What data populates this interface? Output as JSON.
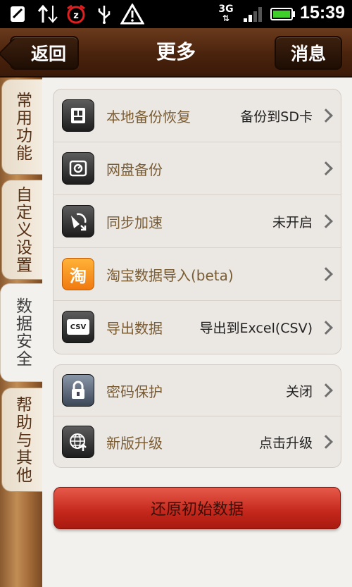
{
  "status_bar": {
    "time": "15:39",
    "network": "3G",
    "icons": [
      "sd-card-icon",
      "data-transfer-icon",
      "alarm-clock-icon",
      "usb-icon",
      "warning-icon",
      "signal-icon",
      "battery-icon"
    ]
  },
  "header": {
    "back_label": "返回",
    "title": "更多",
    "messages_label": "消息"
  },
  "sidebar": {
    "tabs": [
      {
        "label": "常用功能",
        "active": false
      },
      {
        "label": "自定义设置",
        "active": false
      },
      {
        "label": "数据安全",
        "active": true
      },
      {
        "label": "帮助与其他",
        "active": false
      }
    ]
  },
  "groups": [
    {
      "rows": [
        {
          "icon": "local-backup-icon",
          "label": "本地备份恢复",
          "value": "备份到SD卡"
        },
        {
          "icon": "cloud-drive-icon",
          "label": "网盘备份",
          "value": ""
        },
        {
          "icon": "satellite-sync-icon",
          "label": "同步加速",
          "value": "未开启"
        },
        {
          "icon": "taobao-icon",
          "icon_text": "淘",
          "label": "淘宝数据导入(beta)",
          "value": ""
        },
        {
          "icon": "csv-export-icon",
          "icon_text": "CSV",
          "label": "导出数据",
          "value": "导出到Excel(CSV)"
        }
      ]
    },
    {
      "rows": [
        {
          "icon": "lock-icon",
          "label": "密码保护",
          "value": "关闭"
        },
        {
          "icon": "globe-upgrade-icon",
          "label": "新版升级",
          "value": "点击升级"
        }
      ]
    }
  ],
  "reset_button": {
    "label": "还原初始数据"
  },
  "colors": {
    "accent_red": "#c4271b",
    "label_brown": "#7a5c33",
    "header_brown": "#4a230d"
  }
}
